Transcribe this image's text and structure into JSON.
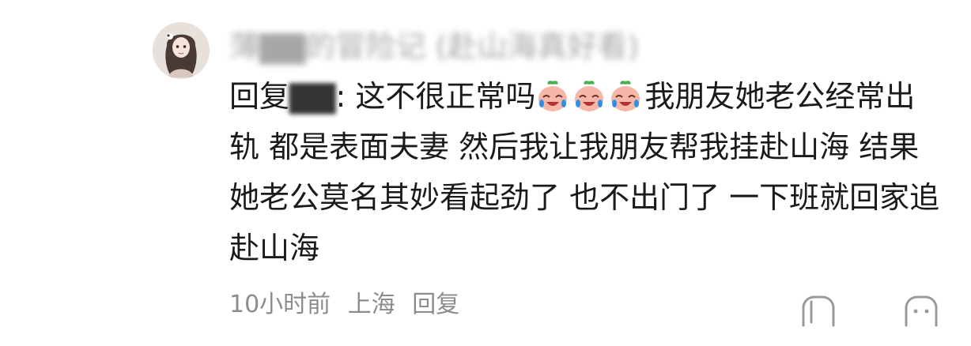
{
  "comment": {
    "username": "薄▇▇的冒险记 (赴山海真好看)",
    "reply_prefix": "回复",
    "reply_target": "▇▇",
    "reply_separator": ": ",
    "text_before_emoji": "这不很正常吗",
    "emoji_name": "crying-laughing-peach-emoji",
    "text_after_emoji": "我朋友她老公经常出轨 都是表面夫妻 然后我让我朋友帮我挂赴山海 结果她老公莫名其妙看起劲了 也不出门了 一下班就回家追赴山海"
  },
  "meta": {
    "time": "10小时前",
    "location": "上海",
    "reply_label": "回复"
  },
  "actions": {
    "like_icon": "thumb-up-icon",
    "more_icon": "more-icon"
  },
  "colors": {
    "text": "#1a1a1a",
    "meta": "#8c8c8c",
    "username": "#8a8a8a"
  }
}
